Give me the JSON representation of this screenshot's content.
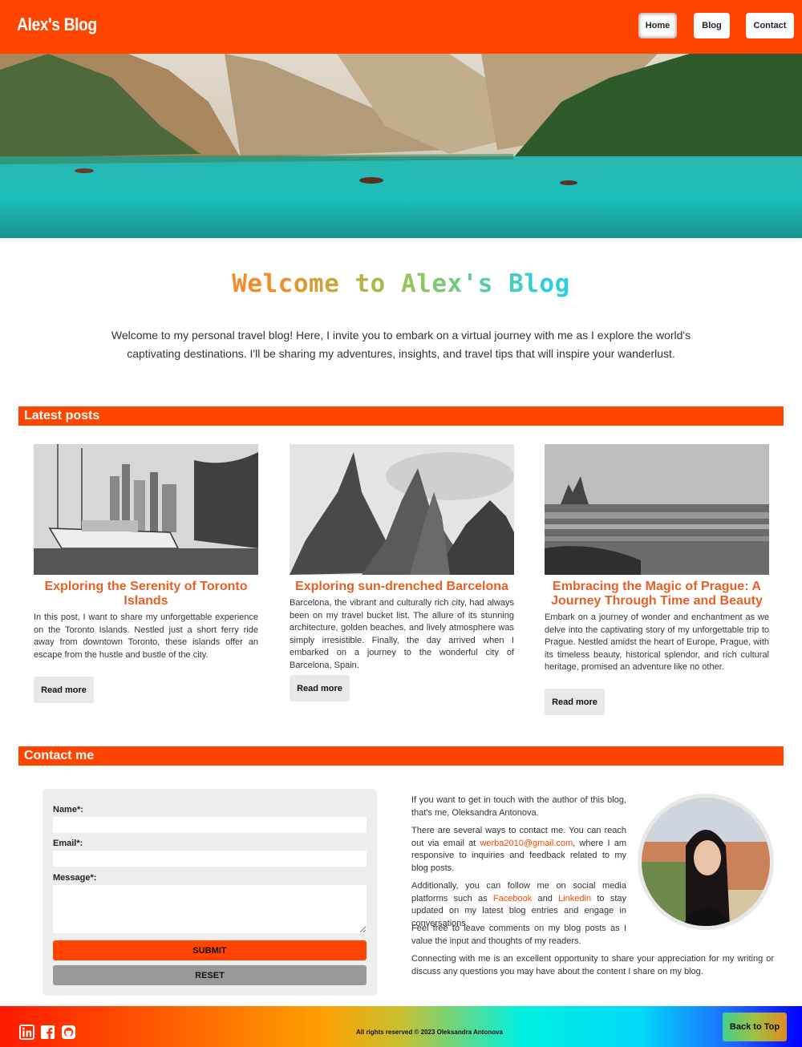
{
  "header": {
    "brand": "Alex's Blog",
    "nav": [
      {
        "label": "Home",
        "active": true
      },
      {
        "label": "Blog"
      },
      {
        "label": "Contact"
      }
    ],
    "color": "#ff4500"
  },
  "welcome": {
    "title": "Welcome to Alex's Blog",
    "text": "Welcome to my personal travel blog! Here, I invite you to embark on a virtual journey with me as I explore the world's captivating destinations. I'll be sharing my adventures, insights, and travel tips that will inspire your wanderlust."
  },
  "latest": {
    "heading": "Latest posts",
    "posts": [
      {
        "title": "Exploring the Serenity of Toronto Islands",
        "text": "In this post, I want to share my unforgettable experience on the Toronto Islands. Nestled just a short ferry ride away from downtown Toronto, these islands offer an escape from the hustle and bustle of the city.",
        "button": "Read more"
      },
      {
        "title": "Exploring sun-drenched Barcelona",
        "text": "Barcelona, the vibrant and culturally rich city, had always been on my travel bucket list. The allure of its stunning architecture, golden beaches, and lively atmosphere was simply irresistible. Finally, the day arrived when I embarked on a journey to the wonderful city of Barcelona, Spain.",
        "button": "Read more"
      },
      {
        "title": "Embracing the Magic of Prague: A Journey Through Time and Beauty",
        "text": "Embark on a journey of wonder and enchantment as we delve into the captivating story of my unforgettable trip to Prague. Nestled amidst the heart of Europe, Prague, with its timeless beauty, historical splendor, and rich cultural heritage, promised an adventure like no other.",
        "button": "Read more"
      }
    ]
  },
  "contact": {
    "heading": "Contact me",
    "form": {
      "name_label": "Name*:",
      "email_label": "Email*:",
      "message_label": "Message*:",
      "name_value": "",
      "email_value": "",
      "message_value": "",
      "submit": "SUBMIT",
      "reset": "RESET"
    },
    "p1": "If you want to get in touch with the author of this blog, that's me, Oleksandra Antonova.",
    "p2_before": "There are several ways to contact me. You can reach out via email at ",
    "email": "werba2010@gmail.com",
    "p2_after": ", where I am responsive to inquiries and feedback related to my blog posts.",
    "p3_before": "Additionally, you can follow me on social media platforms such as ",
    "facebook": "Facebook",
    "p3_and": " and ",
    "linkedin": "Linkedin",
    "p3_after": " to stay updated on my latest blog entries and engage in conversations.",
    "p4": "Feel free to leave comments on my blog posts as I value the input and thoughts of my readers.",
    "p5": "Connecting with me is an excellent opportunity to share your appreciation for my writing or discuss any questions you may have about the content I share on my blog."
  },
  "footer": {
    "social_icons": [
      "linkedin-icon",
      "facebook-icon",
      "github-icon"
    ],
    "copyright": "All rights reserved © 2023 Oleksandra Antonova",
    "back_to_top": "Back to Top"
  }
}
